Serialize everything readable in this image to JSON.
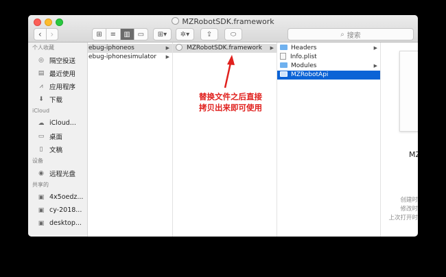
{
  "window": {
    "title": "MZRobotSDK.framework"
  },
  "toolbar": {
    "search_placeholder": "搜索",
    "search_icon": "magnifier-icon",
    "views": [
      "grid-view-icon",
      "list-view-icon",
      "column-view-icon",
      "gallery-view-icon"
    ],
    "active_view": "column"
  },
  "sidebar": {
    "sections": [
      {
        "title": "个人收藏",
        "items": [
          "隔空投送",
          "最近使用",
          "应用程序",
          "下载"
        ]
      },
      {
        "title": "iCloud",
        "items": [
          "iCloud...",
          "桌面",
          "文稿"
        ]
      },
      {
        "title": "设备",
        "items": [
          "远程光盘"
        ]
      },
      {
        "title": "共享的",
        "items": [
          "4x5oedz...",
          "cy-2018...",
          "desktop..."
        ]
      }
    ]
  },
  "columns": {
    "col1": [
      "ebug-iphoneos",
      "ebug-iphonesimulator"
    ],
    "col2": [
      "MZRobotSDK.framework"
    ],
    "col3": [
      "Headers",
      "Info.plist",
      "Modules",
      "MZRobotApi"
    ]
  },
  "preview": {
    "name": "MZ",
    "meta": [
      "创建时",
      "修改时",
      "上次打开时"
    ]
  },
  "annotation": {
    "line1": "替换文件之后直接",
    "line2": "拷贝出来即可使用"
  },
  "colors": {
    "selection_blue": "#0b63d6",
    "annotation_red": "#e0201d"
  }
}
